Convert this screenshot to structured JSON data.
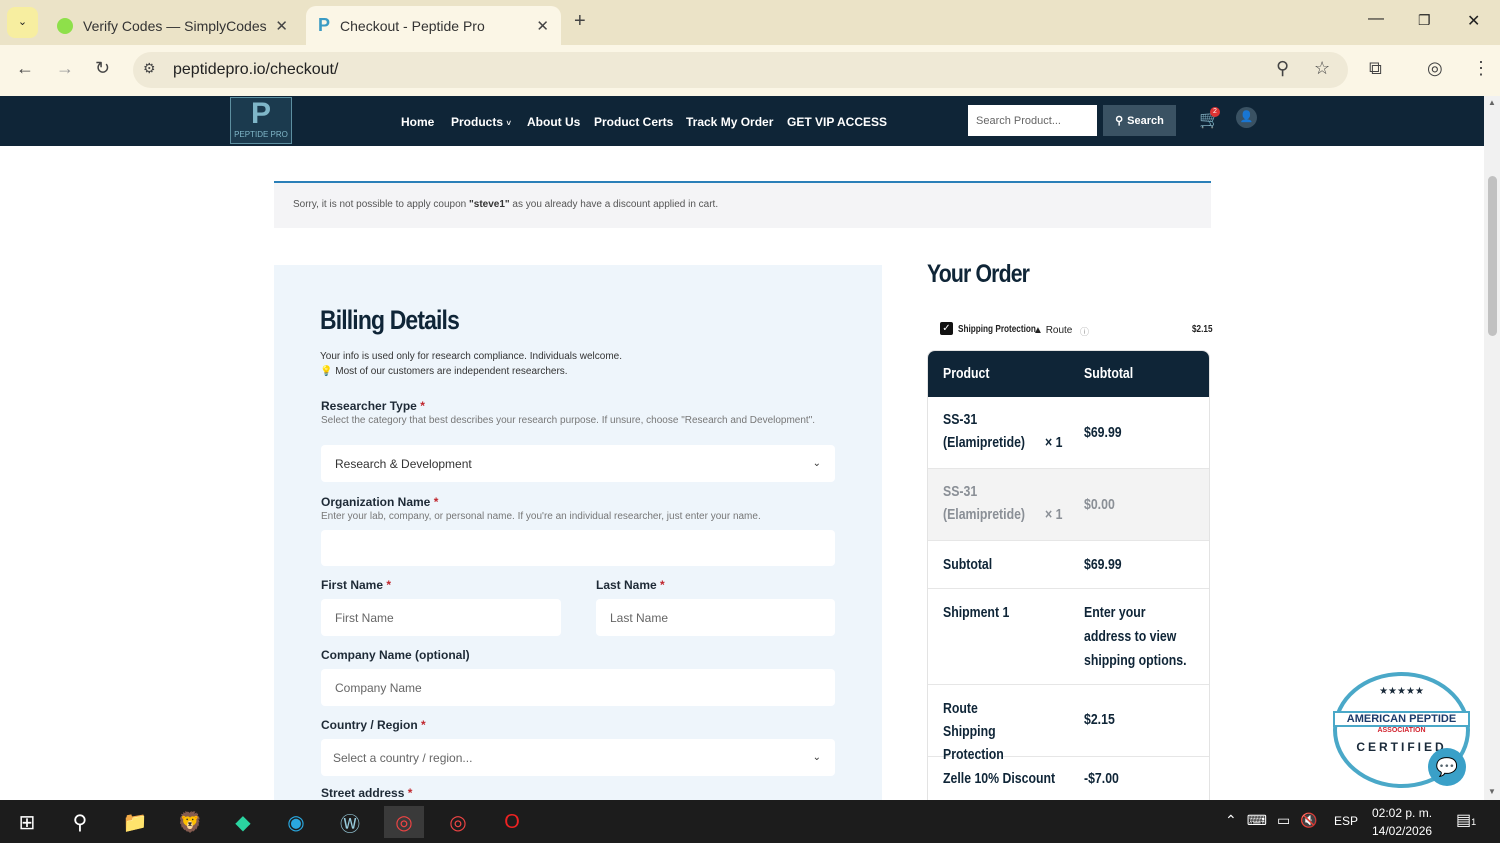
{
  "browser": {
    "tabs": [
      {
        "title": "Verify Codes — SimplyCodes"
      },
      {
        "title": "Checkout - Peptide Pro"
      }
    ],
    "url": "peptidepro.io/checkout/"
  },
  "site": {
    "logo_letter": "P",
    "logo_text": "PEPTIDE PRO",
    "nav": [
      "Home",
      "Products",
      "About Us",
      "Product Certs",
      "Track My Order",
      "GET VIP ACCESS"
    ],
    "search_placeholder": "Search Product...",
    "search_button": "Search",
    "cart_count": "2"
  },
  "notice": {
    "before": "Sorry, it is not possible to apply coupon ",
    "coupon": "\"steve1\"",
    "after": " as you already have a discount applied in cart."
  },
  "billing": {
    "title": "Billing Details",
    "intro": "Your info is used only for research compliance. Individuals welcome.",
    "tip": "Most of our customers are independent researchers.",
    "researcher_type": {
      "label": "Researcher Type",
      "hint": "Select the category that best describes your research purpose. If unsure, choose \"Research and Development\".",
      "value": "Research & Development"
    },
    "org": {
      "label": "Organization Name",
      "hint": "Enter your lab, company, or personal name. If you're an individual researcher, just enter your name.",
      "value": ""
    },
    "first": {
      "label": "First Name",
      "placeholder": "First Name"
    },
    "last": {
      "label": "Last Name",
      "placeholder": "Last Name"
    },
    "company": {
      "label": "Company Name (optional)",
      "placeholder": "Company Name"
    },
    "country": {
      "label": "Country / Region",
      "placeholder": "Select a country / region..."
    },
    "street": {
      "label": "Street address"
    }
  },
  "order": {
    "title": "Your Order",
    "protection_label": "Shipping Protection",
    "route": "Route",
    "protection_price": "$2.15",
    "head": [
      "Product",
      "Subtotal"
    ],
    "rows": [
      {
        "name": "SS-31 (Elamipretide)",
        "qty": "× 1",
        "value": "$69.99"
      },
      {
        "name": "SS-31 (Elamipretide)",
        "qty": "× 1",
        "value": "$0.00"
      },
      {
        "name": "Subtotal",
        "value": "$69.99"
      },
      {
        "name": "Shipment 1",
        "value": "Enter your address to view shipping options."
      },
      {
        "name": "Route Shipping Protection",
        "value": "$2.15"
      },
      {
        "name": "Zelle 10% Discount",
        "value": "-$7.00"
      }
    ]
  },
  "badge": {
    "line1": "AMERICAN PEPTIDE",
    "line2": "ASSOCIATION",
    "line3": "CERTIFIED"
  },
  "taskbar": {
    "lang": "ESP",
    "time": "02:02 p. m.",
    "date": "14/02/2026",
    "notif": "1"
  }
}
